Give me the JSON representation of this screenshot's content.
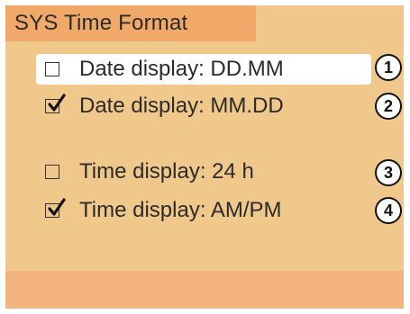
{
  "title": "SYS Time Format",
  "colors": {
    "background": "#f0c88c",
    "title_bar": "#f1a96a",
    "footer_band": "#f3b37c",
    "selected_row": "#ffffff",
    "text": "#2b2b2b"
  },
  "options": [
    {
      "label": "Date display: DD.MM",
      "checked": false,
      "highlighted": true,
      "badge": "1"
    },
    {
      "label": "Date display: MM.DD",
      "checked": true,
      "highlighted": false,
      "badge": "2"
    },
    {
      "label": "Time display: 24 h",
      "checked": false,
      "highlighted": false,
      "badge": "3"
    },
    {
      "label": "Time display: AM/PM",
      "checked": true,
      "highlighted": false,
      "badge": "4"
    }
  ]
}
